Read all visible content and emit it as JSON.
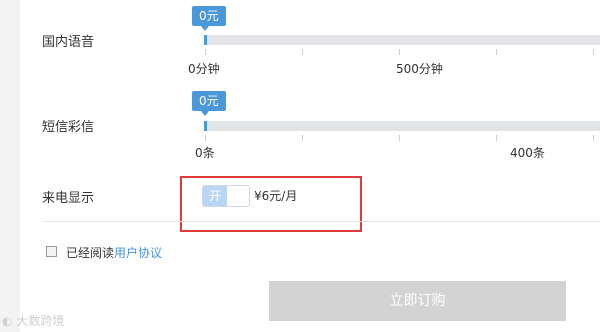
{
  "voice": {
    "label": "国内语音",
    "badge": "0元",
    "tick_labels": [
      "0分钟",
      "500分钟"
    ],
    "value": 0
  },
  "sms": {
    "label": "短信彩信",
    "badge": "0元",
    "tick_labels": [
      "0条",
      "400条"
    ],
    "value": 0
  },
  "caller_id": {
    "label": "来电显示",
    "toggle_label": "开",
    "toggle_on": true,
    "price": "¥6元/月"
  },
  "agreement": {
    "prefix": "已经阅读",
    "link": "用户协议",
    "checked": false
  },
  "order_button": {
    "label": "立即订购"
  },
  "watermark": {
    "text": "大数跨境"
  },
  "colors": {
    "accent": "#4a97d9",
    "highlight_border": "#e03a3a",
    "disabled_button": "#d3d3d3"
  }
}
